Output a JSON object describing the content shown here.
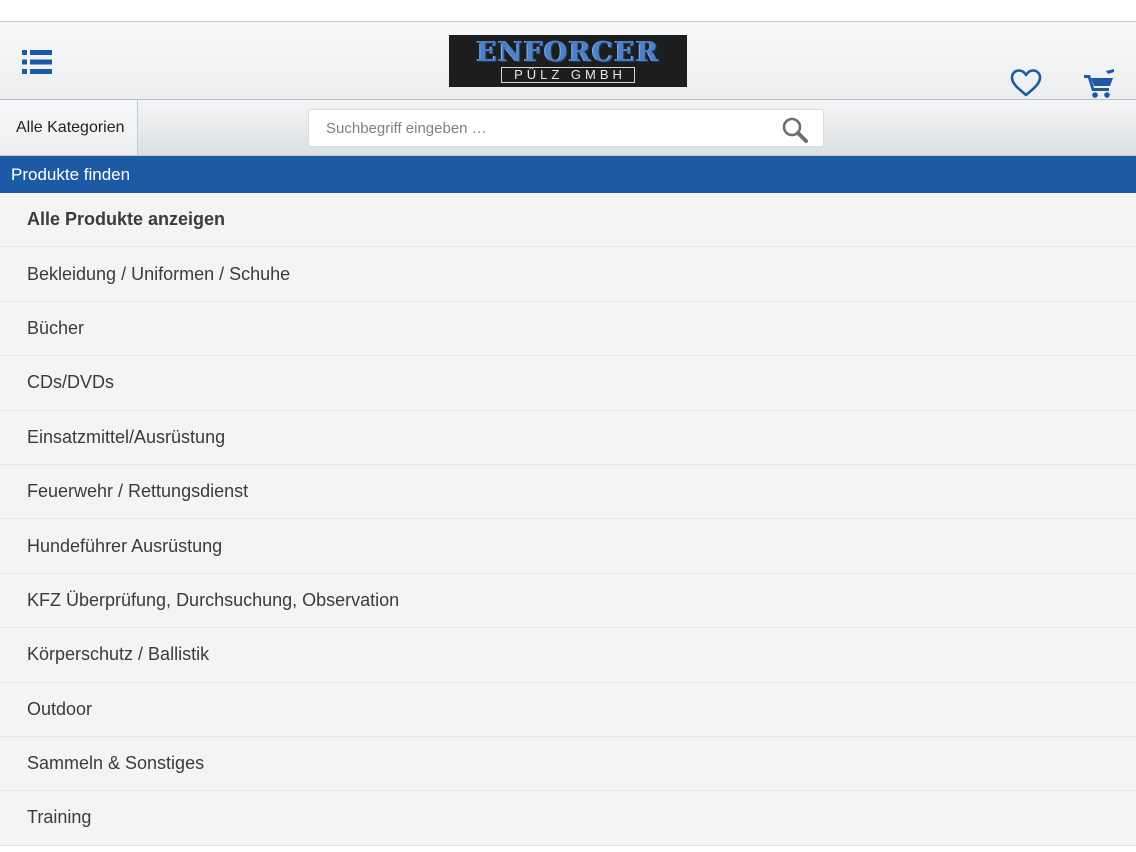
{
  "header": {
    "logo": {
      "title": "ENFORCER",
      "subtitle": "PÜLZ GMBH"
    },
    "icons": {
      "menu": "list-menu-icon",
      "wishlist": "heart-icon",
      "cart": "shopping-cart-icon"
    }
  },
  "toolbar": {
    "categories_label": "Alle Kategorien",
    "search_placeholder": "Suchbegriff eingeben …",
    "search_icon": "magnifier-icon"
  },
  "section": {
    "title": "Produkte finden"
  },
  "categories": [
    "Alle Produkte anzeigen",
    "Bekleidung / Uniformen / Schuhe",
    "Bücher",
    "CDs/DVDs",
    "Einsatzmittel/Ausrüstung",
    "Feuerwehr / Rettungsdienst",
    "Hundeführer Ausrüstung",
    "KFZ Überprüfung, Durchsuchung, Observation",
    "Körperschutz / Ballistik",
    "Outdoor",
    "Sammeln & Sonstiges",
    "Training"
  ],
  "colors": {
    "accent": "#1c5aa5",
    "icon": "#1c5aa5",
    "logo_blue": "#4c80c7"
  }
}
